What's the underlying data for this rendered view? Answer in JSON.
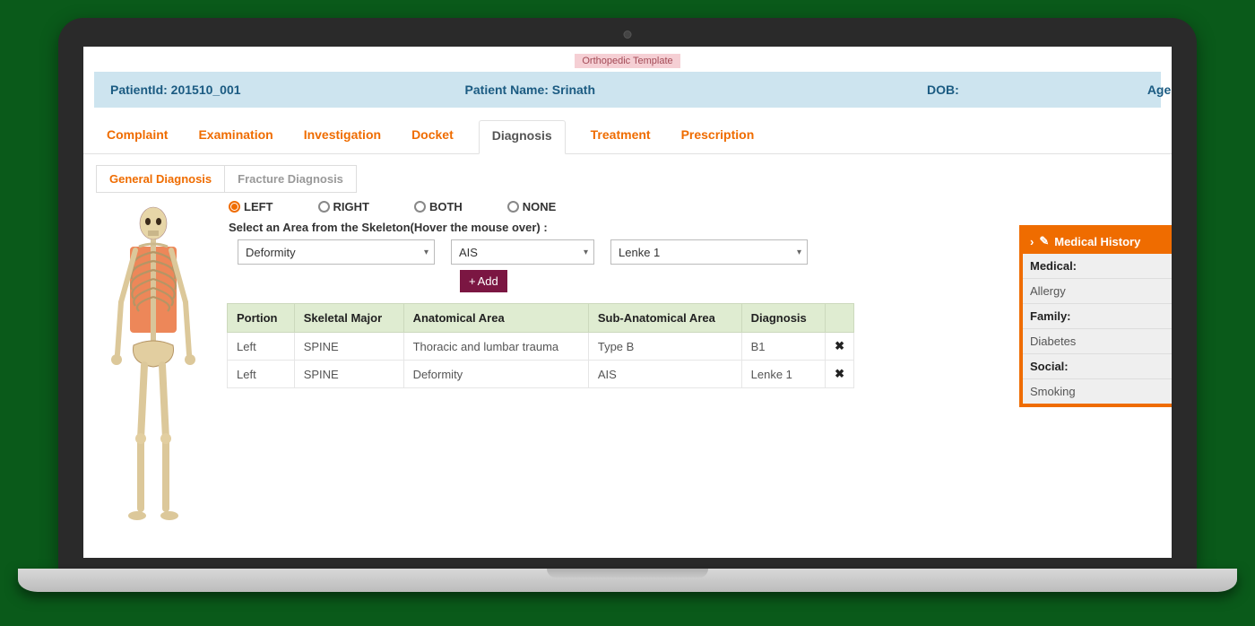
{
  "badge": "Orthopedic Template",
  "patient": {
    "id_label": "PatientId:",
    "id_value": "201510_001",
    "name_label": "Patient Name:",
    "name_value": "Srinath",
    "dob_label": "DOB:",
    "age_label": "Age:"
  },
  "tabs": [
    "Complaint",
    "Examination",
    "Investigation",
    "Docket",
    "Diagnosis",
    "Treatment",
    "Prescription"
  ],
  "active_tab": "Diagnosis",
  "subtabs": [
    "General Diagnosis",
    "Fracture Diagnosis"
  ],
  "active_subtab": "General Diagnosis",
  "side_options": [
    "LEFT",
    "RIGHT",
    "BOTH",
    "NONE"
  ],
  "side_selected": "LEFT",
  "hover_hint": "Select an Area from the Skeleton(Hover the mouse over) :",
  "dropdowns": {
    "d1": "Deformity",
    "d2": "AIS",
    "d3": "Lenke 1"
  },
  "add_label": "Add",
  "table": {
    "headers": [
      "Portion",
      "Skeletal Major",
      "Anatomical Area",
      "Sub-Anatomical Area",
      "Diagnosis"
    ],
    "rows": [
      {
        "portion": "Left",
        "major": "SPINE",
        "area": "Thoracic and lumbar trauma",
        "sub": "Type B",
        "diag": "B1"
      },
      {
        "portion": "Left",
        "major": "SPINE",
        "area": "Deformity",
        "sub": "AIS",
        "diag": "Lenke 1"
      }
    ]
  },
  "history": {
    "title": "Medical History",
    "items": [
      {
        "label": "Medical:",
        "value": "Allergy"
      },
      {
        "label": "Family:",
        "value": "Diabetes"
      },
      {
        "label": "Social:",
        "value": "Smoking"
      }
    ]
  }
}
